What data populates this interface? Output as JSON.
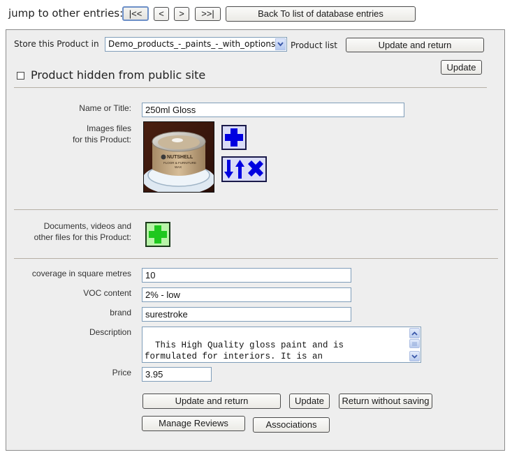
{
  "nav": {
    "jump_label": "jump to other entries:",
    "first_label": "|<<",
    "prev_label": "<",
    "next_label": ">",
    "last_label": ">>|",
    "back_label": "Back To list of database entries"
  },
  "store": {
    "label": "Store this Product in",
    "selected_list": "Demo_products_-_paints_-_with_options",
    "suffix": "Product list",
    "update_return_label": "Update and return",
    "update_label": "Update"
  },
  "hidden": {
    "label": "Product hidden from public site",
    "checked": false
  },
  "product": {
    "name_label": "Name or Title:",
    "name_value": "250ml Gloss",
    "images_label_line1": "Images files",
    "images_label_line2": "for this Product:",
    "image_alt": "Nutshell Floor & Furniture Wax tin",
    "image_brand_text": "NUTSHELL",
    "image_sub_text": "FLOOR & FURNITURE",
    "image_sub_text2": "WAX",
    "add_image_icon": "add-image-icon",
    "reorder_delete_icon": "reorder-delete-icon",
    "docs_label_line1": "Documents, videos and",
    "docs_label_line2": "other files for this Product:",
    "add_doc_icon": "add-document-icon"
  },
  "fields": {
    "coverage_label": "coverage in square metres",
    "coverage_value": "10",
    "voc_label": "VOC content",
    "voc_value": "2% - low",
    "brand_label": "brand",
    "brand_value": "surestroke",
    "description_label": "Description",
    "description_value": "This High Quality gloss paint and is\nformulated for interiors. It is an\necologically sound Gloss with Low VOCs and",
    "price_label": "Price",
    "price_value": "3.95"
  },
  "actions": {
    "update_return_label": "Update and return",
    "update_label": "Update",
    "return_label": "Return without saving",
    "reviews_label": "Manage Reviews",
    "associations_label": "Associations"
  },
  "colors": {
    "panel_bg": "#eeeeee",
    "icon_blue": "#0000e0",
    "icon_green": "#1ec81e",
    "field_border": "#7f9db9"
  }
}
